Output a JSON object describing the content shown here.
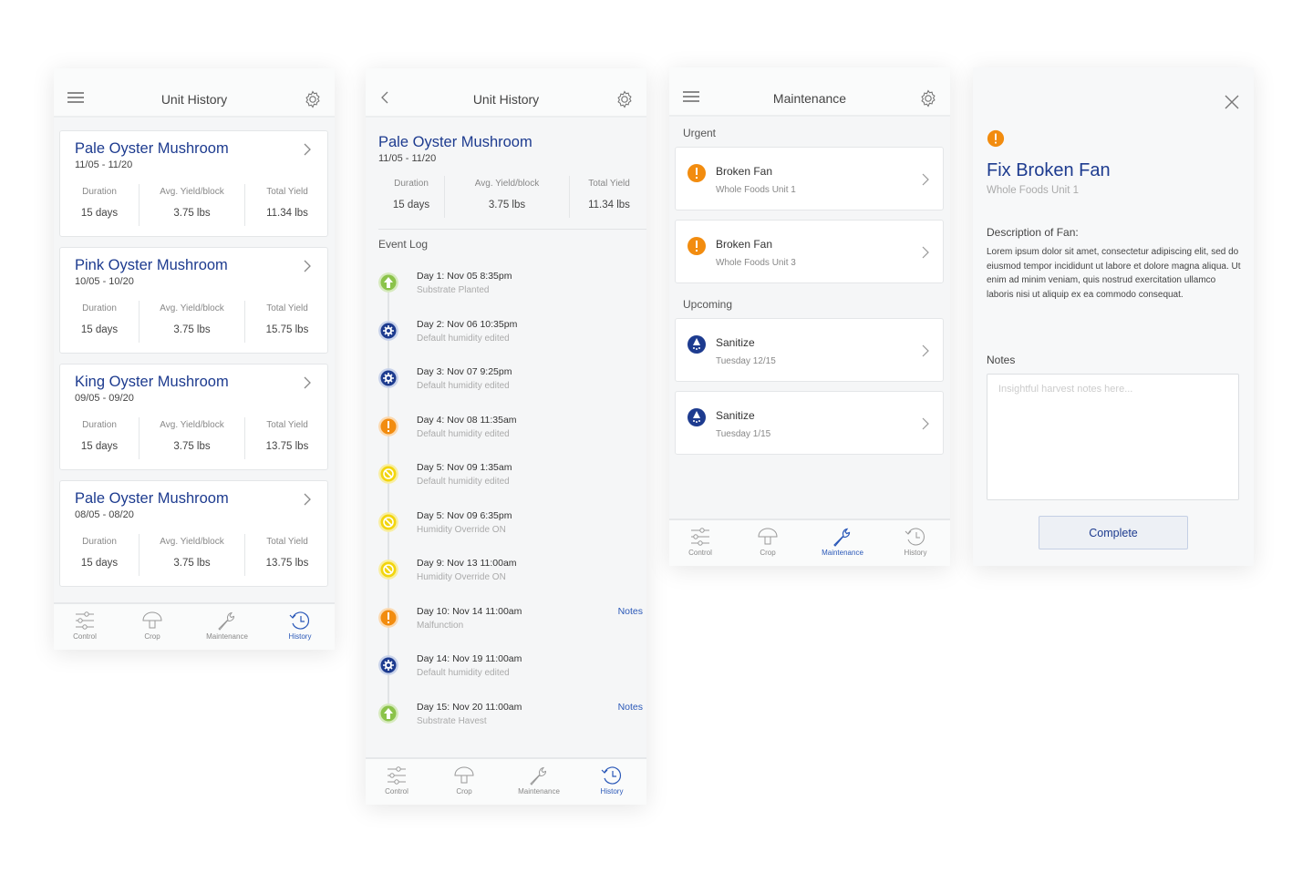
{
  "colors": {
    "brand": "#1d3b8f",
    "accent": "#2a58b8",
    "warning": "#f28c0f",
    "success": "#8bc34a",
    "caution": "#f2d50f"
  },
  "nav_items": [
    "Control",
    "Crop",
    "Maintenance",
    "History"
  ],
  "screen1": {
    "title": "Unit History",
    "cards": [
      {
        "name": "Pale Oyster Mushroom",
        "dates": "11/05 - 11/20",
        "duration_label": "Duration",
        "duration": "15 days",
        "yield_label": "Avg. Yield/block",
        "yield": "3.75 lbs",
        "total_label": "Total Yield",
        "total": "11.34 lbs"
      },
      {
        "name": "Pink Oyster Mushroom",
        "dates": "10/05 - 10/20",
        "duration_label": "Duration",
        "duration": "15 days",
        "yield_label": "Avg. Yield/block",
        "yield": "3.75 lbs",
        "total_label": "Total Yield",
        "total": "15.75 lbs"
      },
      {
        "name": "King Oyster Mushroom",
        "dates": "09/05 - 09/20",
        "duration_label": "Duration",
        "duration": "15 days",
        "yield_label": "Avg. Yield/block",
        "yield": "3.75 lbs",
        "total_label": "Total Yield",
        "total": "13.75 lbs"
      },
      {
        "name": "Pale Oyster Mushroom",
        "dates": "08/05 - 08/20",
        "duration_label": "Duration",
        "duration": "15 days",
        "yield_label": "Avg. Yield/block",
        "yield": "3.75 lbs",
        "total_label": "Total Yield",
        "total": "13.75 lbs"
      }
    ],
    "active_nav": "History"
  },
  "screen2": {
    "title": "Unit History",
    "crop": {
      "name": "Pale Oyster Mushroom",
      "dates": "11/05 - 11/20",
      "duration_label": "Duration",
      "duration": "15 days",
      "yield_label": "Avg. Yield/block",
      "yield": "3.75 lbs",
      "total_label": "Total Yield",
      "total": "11.34 lbs"
    },
    "event_log_title": "Event Log",
    "events": [
      {
        "icon": "arrow-up-icon",
        "color": "#8bc34a",
        "title": "Day 1: Nov 05 8:35pm",
        "sub": "Substrate Planted",
        "notes": ""
      },
      {
        "icon": "gear-icon",
        "color": "#1d3b8f",
        "title": "Day 2: Nov 06 10:35pm",
        "sub": "Default humidity edited",
        "notes": ""
      },
      {
        "icon": "gear-icon",
        "color": "#1d3b8f",
        "title": "Day 3: Nov 07 9:25pm",
        "sub": "Default humidity edited",
        "notes": ""
      },
      {
        "icon": "warning-icon",
        "color": "#f28c0f",
        "title": "Day 4: Nov 08 11:35am",
        "sub": "Default humidity edited",
        "notes": ""
      },
      {
        "icon": "block-icon",
        "color": "#f2d50f",
        "title": "Day 5: Nov 09 1:35am",
        "sub": "Default humidity edited",
        "notes": ""
      },
      {
        "icon": "block-icon",
        "color": "#f2d50f",
        "title": "Day 5: Nov 09 6:35pm",
        "sub": "Humidity Override ON",
        "notes": ""
      },
      {
        "icon": "block-icon",
        "color": "#f2d50f",
        "title": "Day 9: Nov 13  11:00am",
        "sub": "Humidity Override ON",
        "notes": ""
      },
      {
        "icon": "warning-icon",
        "color": "#f28c0f",
        "title": "Day 10: Nov 14 11:00am",
        "sub": "Malfunction",
        "notes": "Notes"
      },
      {
        "icon": "gear-icon",
        "color": "#1d3b8f",
        "title": "Day 14: Nov 19 11:00am",
        "sub": "Default humidity edited",
        "notes": ""
      },
      {
        "icon": "arrow-up-icon",
        "color": "#8bc34a",
        "title": "Day 15: Nov 20 11:00am",
        "sub": "Substrate Havest",
        "notes": "Notes"
      }
    ],
    "active_nav": "History"
  },
  "screen3": {
    "title": "Maintenance",
    "urgent_label": "Urgent",
    "upcoming_label": "Upcoming",
    "urgent": [
      {
        "title": "Broken Fan",
        "sub": "Whole Foods Unit 1"
      },
      {
        "title": "Broken Fan",
        "sub": "Whole Foods Unit 3"
      }
    ],
    "upcoming": [
      {
        "title": "Sanitize",
        "sub": "Tuesday 12/15"
      },
      {
        "title": "Sanitize",
        "sub": "Tuesday 1/15"
      }
    ],
    "active_nav": "Maintenance"
  },
  "screen4": {
    "title": "Fix Broken Fan",
    "subtitle": "Whole Foods Unit 1",
    "description_heading": "Description of Fan:",
    "description": "Lorem ipsum dolor sit amet, consectetur adipiscing elit, sed do eiusmod tempor incididunt ut labore et dolore magna aliqua. Ut enim ad minim veniam, quis nostrud exercitation ullamco laboris nisi ut aliquip ex ea commodo consequat.",
    "notes_heading": "Notes",
    "notes_placeholder": "Insightful harvest notes here...",
    "notes_value": "",
    "complete_label": "Complete"
  }
}
